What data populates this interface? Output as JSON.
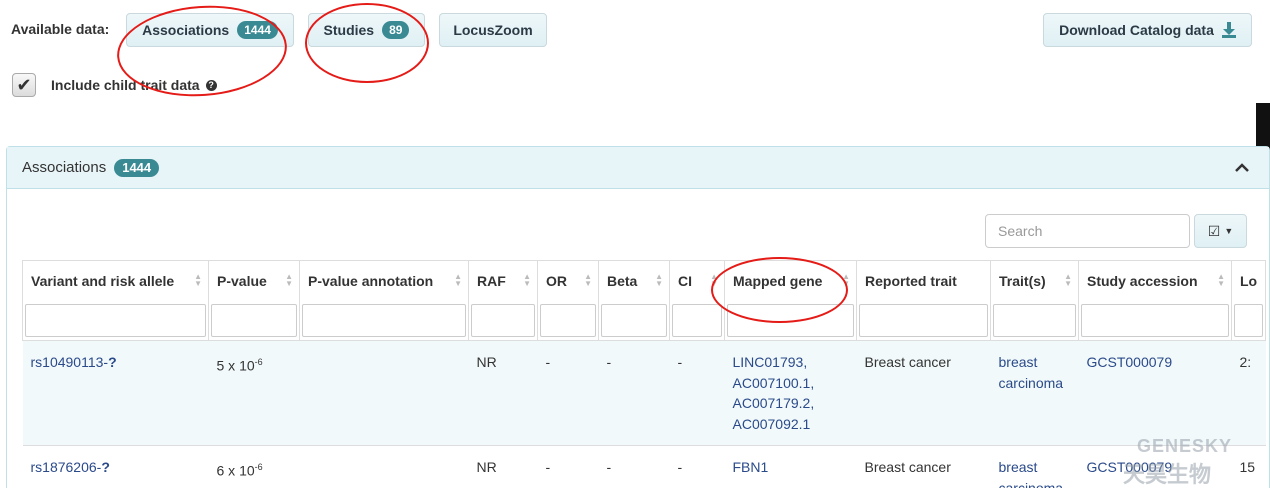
{
  "toolbar": {
    "available_label": "Available data:",
    "associations_label": "Associations",
    "associations_count": "1444",
    "studies_label": "Studies",
    "studies_count": "89",
    "locuszoom_label": "LocusZoom",
    "download_label": "Download Catalog data"
  },
  "child_trait": {
    "label": "Include child trait data",
    "checked": true
  },
  "panel": {
    "title": "Associations",
    "count": "1444"
  },
  "search": {
    "placeholder": "Search"
  },
  "table": {
    "columns": [
      "Variant and risk allele",
      "P-value",
      "P-value annotation",
      "RAF",
      "OR",
      "Beta",
      "CI",
      "Mapped gene",
      "Reported trait",
      "Trait(s)",
      "Study accession",
      "Lo"
    ],
    "rows": [
      {
        "variant": "rs10490113-",
        "allele": "?",
        "pvalue_base": "5 x 10",
        "pvalue_exp": "-6",
        "annotation": "",
        "raf": "NR",
        "or": "-",
        "beta": "-",
        "ci": "-",
        "genes": [
          "LINC01793,",
          "AC007100.1,",
          "AC007179.2,",
          "AC007092.1"
        ],
        "reported_trait": "Breast cancer",
        "traits": [
          "breast",
          "carcinoma"
        ],
        "study": "GCST000079",
        "location": "2:"
      },
      {
        "variant": "rs1876206-",
        "allele": "?",
        "pvalue_base": "6 x 10",
        "pvalue_exp": "-6",
        "annotation": "",
        "raf": "NR",
        "or": "-",
        "beta": "-",
        "ci": "-",
        "genes": [
          "FBN1"
        ],
        "reported_trait": "Breast cancer",
        "traits": [
          "breast",
          "carcinoma"
        ],
        "study": "GCST000079",
        "location": "15"
      }
    ]
  },
  "watermark": {
    "line1": "GENESKY",
    "line2": "天昊生物"
  },
  "colors": {
    "badge": "#3a8a94",
    "link": "#2a4a8a",
    "annotation_circle": "#e41b17"
  }
}
